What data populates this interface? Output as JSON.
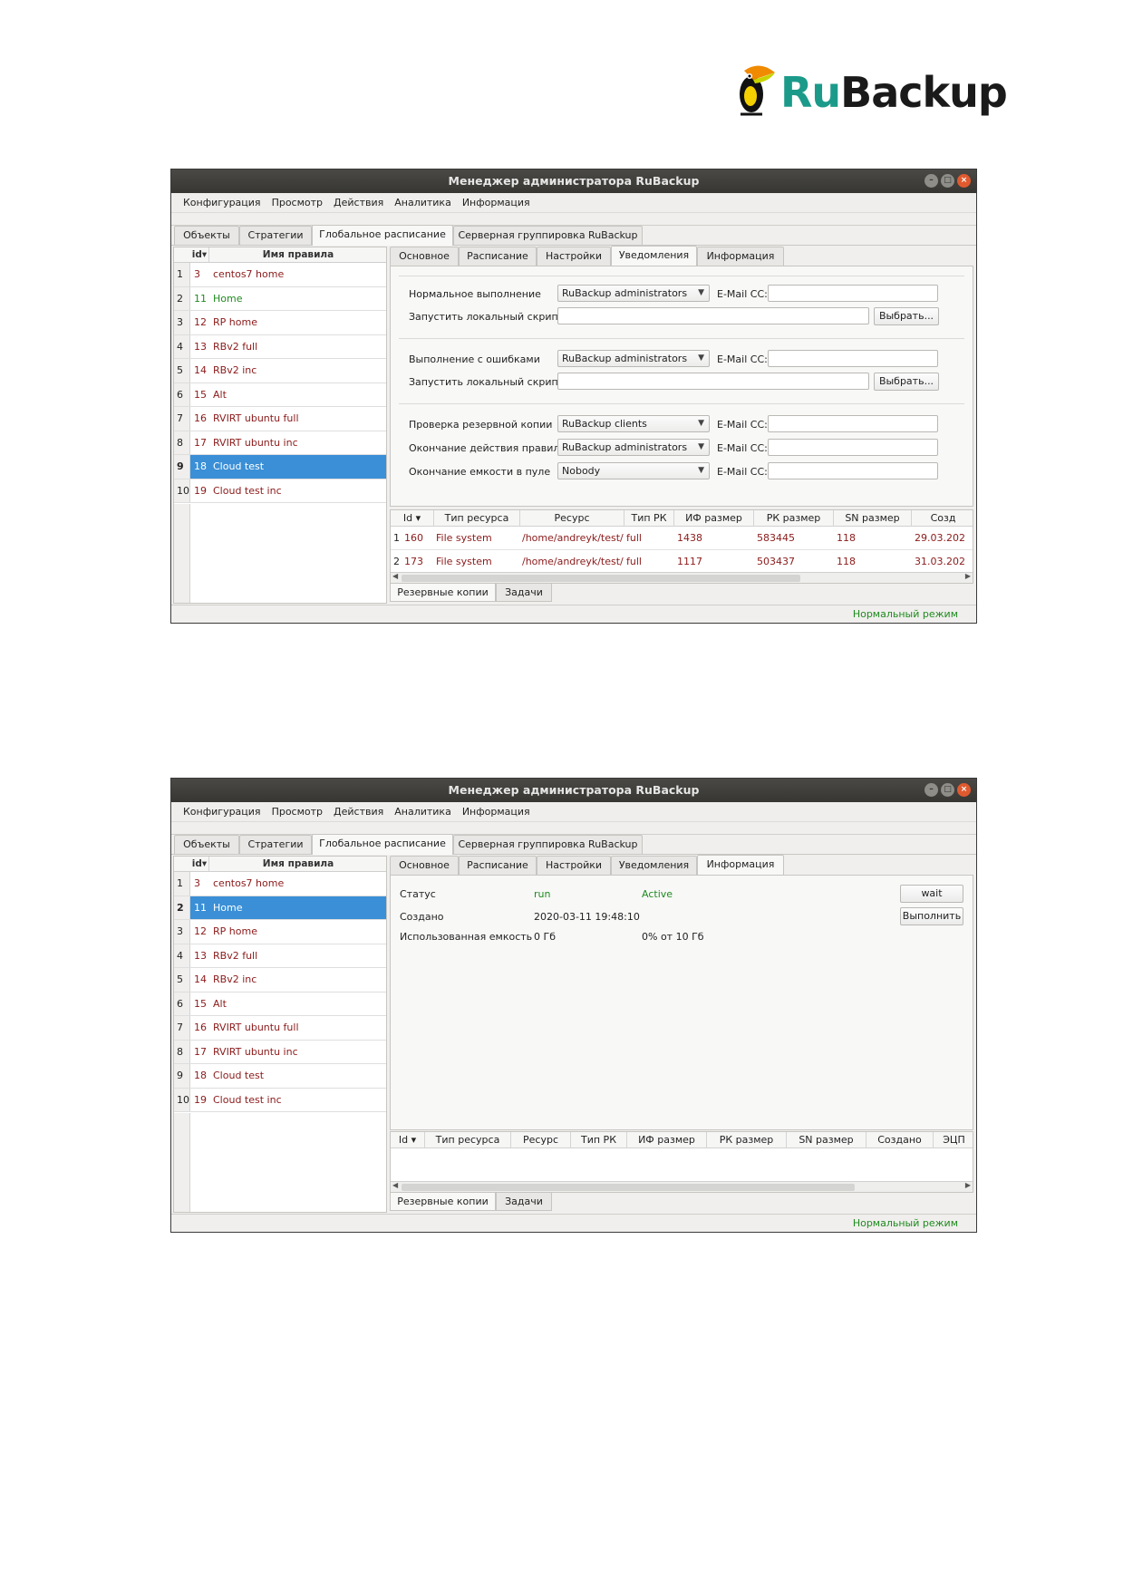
{
  "logo": {
    "ru": "Ru",
    "backup": "Backup"
  },
  "windows": [
    {
      "title": "Менеджер администратора RuBackup",
      "menu": [
        "Конфигурация",
        "Просмотр",
        "Действия",
        "Аналитика",
        "Информация"
      ],
      "top_tabs": [
        "Объекты",
        "Стратегии",
        "Глобальное расписание",
        "Серверная группировка RuBackup"
      ],
      "active_top_tab": "Глобальное расписание",
      "list_headers": {
        "id": "id",
        "name": "Имя правила"
      },
      "rules": [
        {
          "n": "1",
          "id": "3",
          "name": "centos7 home"
        },
        {
          "n": "2",
          "id": "11",
          "name": "Home"
        },
        {
          "n": "3",
          "id": "12",
          "name": "RP home"
        },
        {
          "n": "4",
          "id": "13",
          "name": "RBv2 full"
        },
        {
          "n": "5",
          "id": "14",
          "name": "RBv2 inc"
        },
        {
          "n": "6",
          "id": "15",
          "name": "Alt"
        },
        {
          "n": "7",
          "id": "16",
          "name": "RVIRT ubuntu full"
        },
        {
          "n": "8",
          "id": "17",
          "name": "RVIRT ubuntu inc"
        },
        {
          "n": "9",
          "id": "18",
          "name": "Cloud test"
        },
        {
          "n": "10",
          "id": "19",
          "name": "Cloud test inc"
        }
      ],
      "selected_rule": "9",
      "sub_tabs": [
        "Основное",
        "Расписание",
        "Настройки",
        "Уведомления",
        "Информация"
      ],
      "active_sub_tab": "Уведомления",
      "notifications": {
        "normal_label": "Нормальное выполнение",
        "normal_value": "RuBackup administrators",
        "email_cc": "E-Mail CC:",
        "run_script_label": "Запустить локальный скрипт",
        "choose_button": "Выбрать...",
        "errors_label": "Выполнение с ошибками",
        "errors_value": "RuBackup administrators",
        "check_label": "Проверка резервной копии",
        "check_value": "RuBackup clients",
        "expire_label": "Окончание действия правила",
        "expire_value": "RuBackup administrators",
        "pool_label": "Окончание емкости в пуле",
        "pool_value": "Nobody"
      },
      "table_headers": [
        "Id",
        "Тип ресурса",
        "Ресурс",
        "Тип РК",
        "ИФ размер",
        "РК размер",
        "SN размер",
        "Созд"
      ],
      "table_rows": [
        {
          "n": "1",
          "id": "160",
          "type": "File system",
          "res": "/home/andreyk/test/",
          "rk": "full",
          "if": "1438",
          "rks": "583445",
          "sn": "118",
          "date": "29.03.202"
        },
        {
          "n": "2",
          "id": "173",
          "type": "File system",
          "res": "/home/andreyk/test/",
          "rk": "full",
          "if": "1117",
          "rks": "503437",
          "sn": "118",
          "date": "31.03.202"
        }
      ],
      "bottom_tabs": [
        "Резервные копии",
        "Задачи"
      ],
      "status": "Нормальный режим"
    },
    {
      "title": "Менеджер администратора RuBackup",
      "menu": [
        "Конфигурация",
        "Просмотр",
        "Действия",
        "Аналитика",
        "Информация"
      ],
      "top_tabs": [
        "Объекты",
        "Стратегии",
        "Глобальное расписание",
        "Серверная группировка RuBackup"
      ],
      "active_top_tab": "Глобальное расписание",
      "list_headers": {
        "id": "id",
        "name": "Имя правила"
      },
      "rules": [
        {
          "n": "1",
          "id": "3",
          "name": "centos7 home"
        },
        {
          "n": "2",
          "id": "11",
          "name": "Home"
        },
        {
          "n": "3",
          "id": "12",
          "name": "RP home"
        },
        {
          "n": "4",
          "id": "13",
          "name": "RBv2 full"
        },
        {
          "n": "5",
          "id": "14",
          "name": "RBv2 inc"
        },
        {
          "n": "6",
          "id": "15",
          "name": "Alt"
        },
        {
          "n": "7",
          "id": "16",
          "name": "RVIRT ubuntu full"
        },
        {
          "n": "8",
          "id": "17",
          "name": "RVIRT ubuntu inc"
        },
        {
          "n": "9",
          "id": "18",
          "name": "Cloud test"
        },
        {
          "n": "10",
          "id": "19",
          "name": "Cloud test inc"
        }
      ],
      "selected_rule": "2",
      "sub_tabs": [
        "Основное",
        "Расписание",
        "Настройки",
        "Уведомления",
        "Информация"
      ],
      "active_sub_tab": "Информация",
      "info": {
        "status_label": "Статус",
        "status_value": "run",
        "status_state": "Active",
        "created_label": "Создано",
        "created_value": "2020-03-11 19:48:10",
        "used_label": "Использованная емкость",
        "used_value": "0 Гб",
        "used_pct": "0% от 10 Гб",
        "wait_button": "wait",
        "run_button": "Выполнить"
      },
      "table_headers": [
        "Id",
        "Тип ресурса",
        "Ресурс",
        "Тип РК",
        "ИФ размер",
        "РК размер",
        "SN размер",
        "Создано",
        "ЭЦП"
      ],
      "table_rows": [],
      "bottom_tabs": [
        "Резервные копии",
        "Задачи"
      ],
      "status": "Нормальный режим"
    }
  ]
}
